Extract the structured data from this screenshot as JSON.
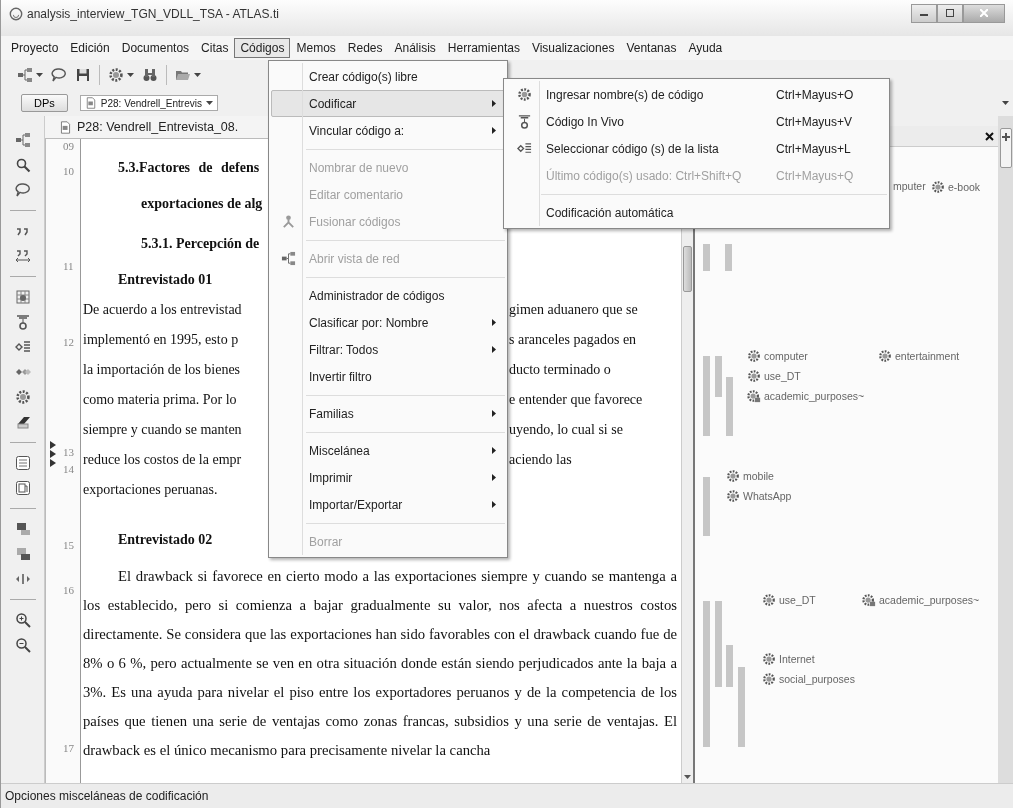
{
  "window": {
    "title": "analysis_interview_TGN_VDLL_TSA - ATLAS.ti"
  },
  "menu_bar": [
    {
      "label": "Proyecto",
      "selected": false
    },
    {
      "label": "Edición",
      "selected": false
    },
    {
      "label": "Documentos",
      "selected": false
    },
    {
      "label": "Citas",
      "selected": false
    },
    {
      "label": "Códigos",
      "selected": true
    },
    {
      "label": "Memos",
      "selected": false
    },
    {
      "label": "Redes",
      "selected": false
    },
    {
      "label": "Análisis",
      "selected": false
    },
    {
      "label": "Herramientas",
      "selected": false
    },
    {
      "label": "Visualizaciones",
      "selected": false
    },
    {
      "label": "Ventanas",
      "selected": false
    },
    {
      "label": "Ayuda",
      "selected": false
    }
  ],
  "toolbar": {
    "dps_button": "DPs",
    "document_selector": "P28: Vendrell_Entrevis"
  },
  "document": {
    "tab": "P28: Vendrell_Entrevista_08.",
    "line_numbers": [
      "09",
      "10",
      "11",
      "12",
      "13",
      "14",
      "15",
      "16",
      "17"
    ],
    "lines": [
      {
        "kind": "heading",
        "left": "5.3.Factores de defens"
      },
      {
        "kind": "heading_cont",
        "left": "exportaciones de alg"
      },
      {
        "kind": "subheading",
        "left": "5.3.1. Percepción de"
      },
      {
        "kind": "speaker",
        "left": "Entrevistado 01"
      },
      {
        "kind": "line",
        "left": "De acuerdo a los entrevistad",
        "right": "gimen aduanero que se"
      },
      {
        "kind": "line",
        "left": "implementó en 1995, esto p",
        "right": "s aranceles pagados en"
      },
      {
        "kind": "line",
        "left": "la importación de los bienes",
        "right": "ducto terminado o"
      },
      {
        "kind": "line",
        "left": "como materia prima. Por lo",
        "right": "e entender que favorece"
      },
      {
        "kind": "line",
        "left": "siempre y cuando se manten",
        "right": "uyendo, lo cual si se"
      },
      {
        "kind": "line",
        "left": "reduce los costos de la empr",
        "right": "aciendo las"
      },
      {
        "kind": "line",
        "left": "exportaciones peruanas."
      },
      {
        "kind": "speaker",
        "left": "Entrevistado 02"
      },
      {
        "kind": "paragraph",
        "left": "El drawback si favorece en cierto modo a las exportaciones siempre y cuando se mantenga a los establecido, pero si comienza a bajar gradualmente su valor, nos afecta a nuestros costos directamente. Se considera que las exportaciones han sido favorables con el drawback cuando fue de 8% o 6 %, pero actualmente se ven en otra situación donde están siendo perjudicados ante la baja a 3%. Es una ayuda para nivelar el piso entre los exportadores peruanos y de la competencia de los países que tienen una serie de ventajas como zonas francas, subsidios y una serie de ventajas. El drawback es el único mecanismo para precisamente nivelar la cancha"
      }
    ]
  },
  "margin_area": {
    "codes": [
      {
        "label": "mputer",
        "kind": "clipped"
      },
      {
        "label": "e-book",
        "kind": "code"
      },
      {
        "label": "computer",
        "kind": "code"
      },
      {
        "label": "entertainment",
        "kind": "code"
      },
      {
        "label": "use_DT",
        "kind": "code"
      },
      {
        "label": "academic_purposes~",
        "kind": "commented_code"
      },
      {
        "label": "mobile",
        "kind": "code"
      },
      {
        "label": "WhatsApp",
        "kind": "code"
      },
      {
        "label": "use_DT",
        "kind": "code"
      },
      {
        "label": "academic_purposes~",
        "kind": "commented_code"
      },
      {
        "label": "Internet",
        "kind": "code"
      },
      {
        "label": "social_purposes",
        "kind": "code"
      }
    ]
  },
  "codes_menu": {
    "items": [
      {
        "kind": "item",
        "label": "Crear código(s) libre",
        "disabled": false,
        "submenu": false,
        "selected": false
      },
      {
        "kind": "item",
        "label": "Codificar",
        "disabled": false,
        "submenu": true,
        "selected": true
      },
      {
        "kind": "item",
        "label": "Vincular código a:",
        "disabled": false,
        "submenu": true,
        "selected": false
      },
      {
        "kind": "separator"
      },
      {
        "kind": "item",
        "label": "Nombrar de nuevo",
        "disabled": true,
        "submenu": false,
        "selected": false
      },
      {
        "kind": "item",
        "label": "Editar comentario",
        "disabled": true,
        "submenu": false,
        "selected": false
      },
      {
        "kind": "item",
        "label": "Fusionar códigos",
        "disabled": true,
        "submenu": false,
        "selected": false
      },
      {
        "kind": "separator"
      },
      {
        "kind": "item",
        "label": "Abrir vista de red",
        "disabled": true,
        "submenu": false,
        "selected": false
      },
      {
        "kind": "separator"
      },
      {
        "kind": "item",
        "label": "Administrador de códigos",
        "disabled": false,
        "submenu": false,
        "selected": false
      },
      {
        "kind": "item",
        "label": "Clasificar por: Nombre",
        "disabled": false,
        "submenu": true,
        "selected": false
      },
      {
        "kind": "item",
        "label": "Filtrar: Todos",
        "disabled": false,
        "submenu": true,
        "selected": false
      },
      {
        "kind": "item",
        "label": "Invertir filtro",
        "disabled": false,
        "submenu": false,
        "selected": false
      },
      {
        "kind": "separator"
      },
      {
        "kind": "item",
        "label": "Familias",
        "disabled": false,
        "submenu": true,
        "selected": false
      },
      {
        "kind": "separator"
      },
      {
        "kind": "item",
        "label": "Miscelánea",
        "disabled": false,
        "submenu": true,
        "selected": false
      },
      {
        "kind": "item",
        "label": "Imprimir",
        "disabled": false,
        "submenu": true,
        "selected": false
      },
      {
        "kind": "item",
        "label": "Importar/Exportar",
        "disabled": false,
        "submenu": true,
        "selected": false
      },
      {
        "kind": "separator"
      },
      {
        "kind": "item",
        "label": "Borrar",
        "disabled": true,
        "submenu": false,
        "selected": false
      }
    ]
  },
  "codificar_submenu": {
    "items": [
      {
        "kind": "item",
        "label": "Ingresar nombre(s) de código",
        "shortcut": "Ctrl+Mayus+O",
        "disabled": false
      },
      {
        "kind": "item",
        "label": "Código In Vivo",
        "shortcut": "Ctrl+Mayus+V",
        "disabled": false
      },
      {
        "kind": "item",
        "label": "Seleccionar código (s) de la lista",
        "shortcut": "Ctrl+Mayus+L",
        "disabled": false
      },
      {
        "kind": "item",
        "label": "Último código(s) usado: Ctrl+Shift+Q",
        "shortcut": "Ctrl+Mayus+Q",
        "disabled": true
      },
      {
        "kind": "separator"
      },
      {
        "kind": "item",
        "label": "Codificación automática",
        "disabled": false
      }
    ]
  },
  "status_bar": "Opciones misceláneas de codificación"
}
